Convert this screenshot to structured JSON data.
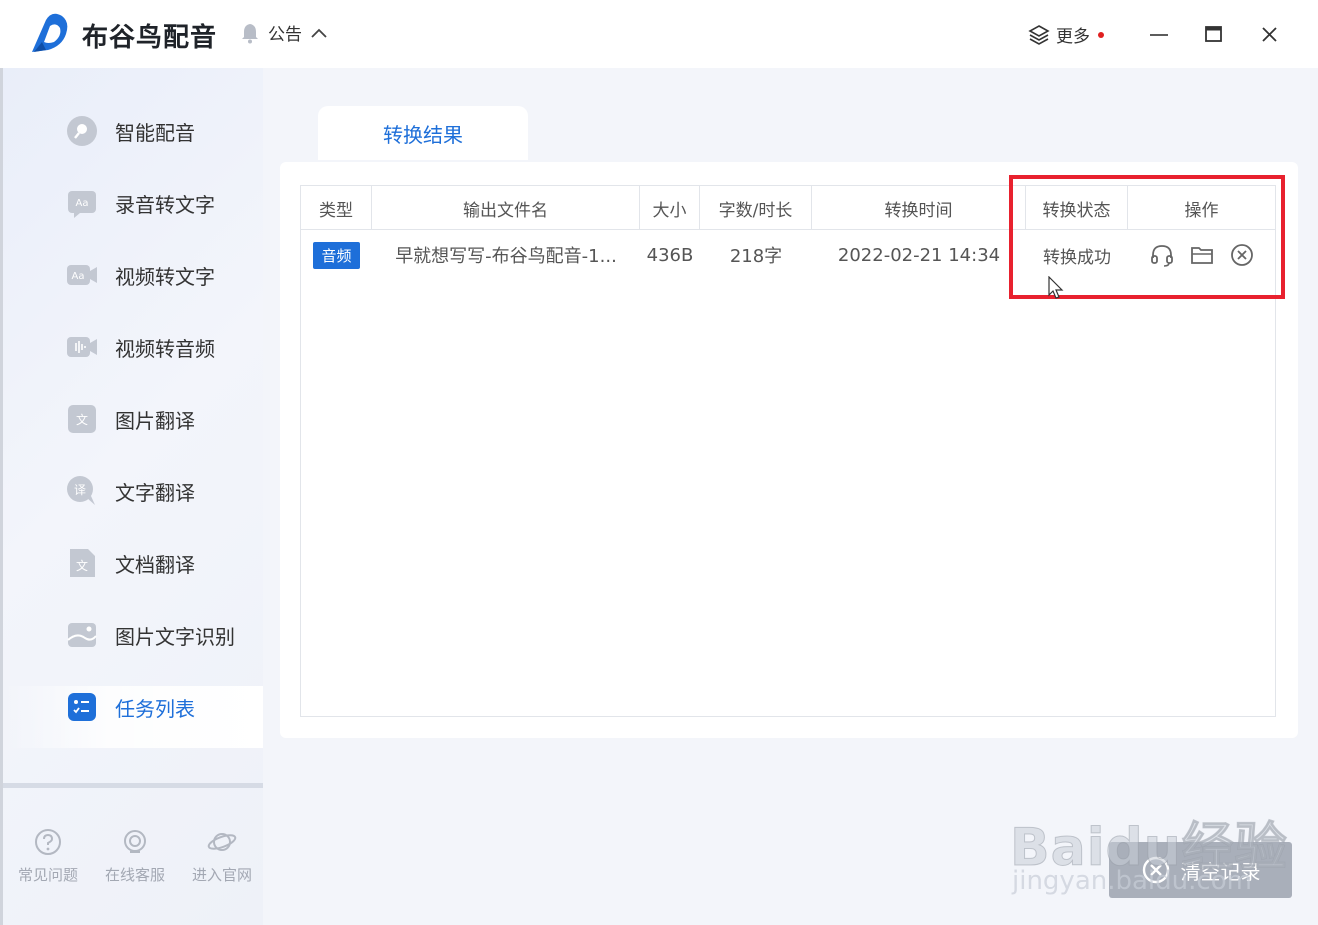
{
  "app": {
    "title": "布谷鸟配音",
    "notice_label": "公告",
    "more_label": "更多",
    "accent": "#1e6fd9",
    "highlight_color": "#e8212e"
  },
  "sidebar": {
    "items": [
      {
        "label": "智能配音",
        "icon": "mic-icon"
      },
      {
        "label": "录音转文字",
        "icon": "recording-to-text-icon"
      },
      {
        "label": "视频转文字",
        "icon": "video-to-text-icon"
      },
      {
        "label": "视频转音频",
        "icon": "video-to-audio-icon"
      },
      {
        "label": "图片翻译",
        "icon": "image-translate-icon"
      },
      {
        "label": "文字翻译",
        "icon": "text-translate-icon"
      },
      {
        "label": "文档翻译",
        "icon": "document-translate-icon"
      },
      {
        "label": "图片文字识别",
        "icon": "image-ocr-icon"
      },
      {
        "label": "任务列表",
        "icon": "task-list-icon",
        "active": true
      }
    ],
    "footer": [
      {
        "label": "常见问题",
        "icon": "question-icon"
      },
      {
        "label": "在线客服",
        "icon": "customer-service-icon"
      },
      {
        "label": "进入官网",
        "icon": "planet-icon"
      }
    ]
  },
  "main": {
    "tab_label": "转换结果",
    "table": {
      "headers": [
        "类型",
        "输出文件名",
        "大小",
        "字数/时长",
        "转换时间",
        "转换状态",
        "操作"
      ],
      "rows": [
        {
          "type": "音频",
          "filename": "早就想写写-布谷鸟配音-1...",
          "size": "436B",
          "length": "218字",
          "time": "2022-02-21 14:34",
          "status": "转换成功"
        }
      ]
    },
    "clear_button": "清空记录"
  },
  "watermark": {
    "big": "Baidu经验",
    "small": "jingyan.baidu.com"
  }
}
